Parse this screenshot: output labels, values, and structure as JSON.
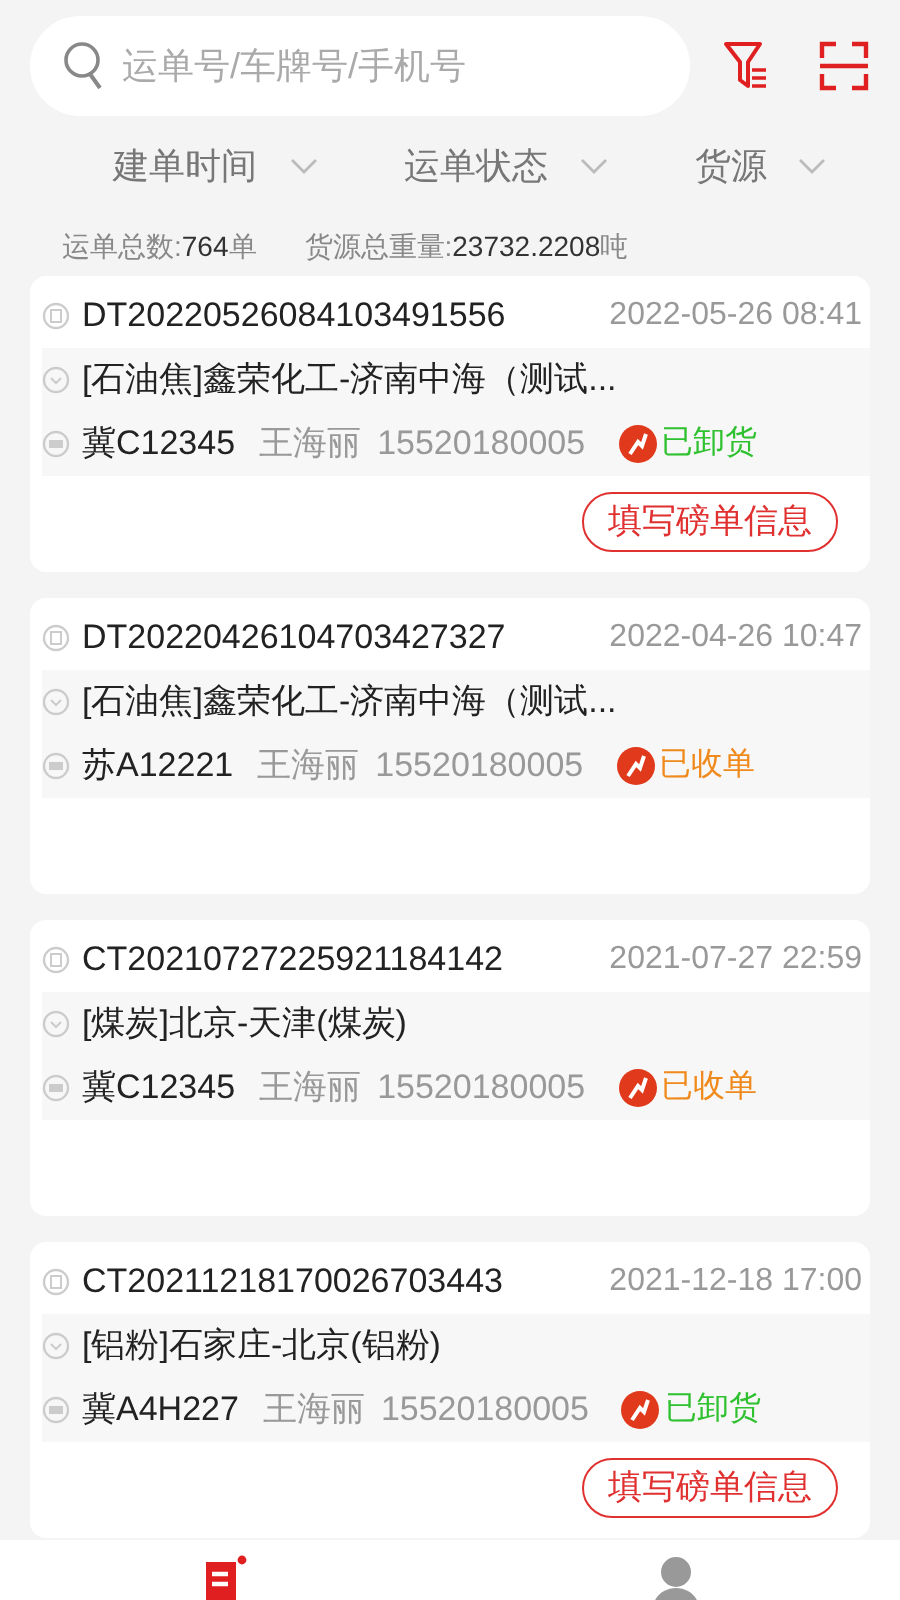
{
  "search": {
    "placeholder": "运单号/车牌号/手机号"
  },
  "filters": [
    {
      "label": "建单时间"
    },
    {
      "label": "运单状态"
    },
    {
      "label": "货源"
    }
  ],
  "summary": {
    "count_label": "运单总数:",
    "count": "764",
    "count_unit": "单",
    "weight_label": "货源总重量:",
    "weight": "23732.2208",
    "weight_unit": "吨"
  },
  "orders": [
    {
      "number": "DT20220526084103491556",
      "time": "2022-05-26 08:41",
      "route": "[石油焦]鑫荣化工-济南中海（测试...",
      "plate": "冀C12345",
      "driver": "王海丽",
      "phone": "15520180005",
      "status": "已卸货",
      "color": "#2fc12f",
      "button": "填写磅单信息"
    },
    {
      "number": "DT20220426104703427327",
      "time": "2022-04-26 10:47",
      "route": "[石油焦]鑫荣化工-济南中海（测试...",
      "plate": "苏A12221",
      "driver": "王海丽",
      "phone": "15520180005",
      "status": "已收单",
      "color": "#f08a1c"
    },
    {
      "number": "CT20210727225921184142",
      "time": "2021-07-27 22:59",
      "route": "[煤炭]北京-天津(煤炭)",
      "plate": "冀C12345",
      "driver": "王海丽",
      "phone": "15520180005",
      "status": "已收单",
      "color": "#f08a1c"
    },
    {
      "number": "CT20211218170026703443",
      "time": "2021-12-18 17:00",
      "route": "[铝粉]石家庄-北京(铝粉)",
      "plate": "冀A4H227",
      "driver": "王海丽",
      "phone": "15520180005",
      "status": "已卸货",
      "color": "#2fc12f",
      "button": "填写磅单信息"
    }
  ],
  "tabbar": [
    {
      "kind": "orders",
      "selected": true
    },
    {
      "kind": "profile",
      "selected": false
    }
  ]
}
